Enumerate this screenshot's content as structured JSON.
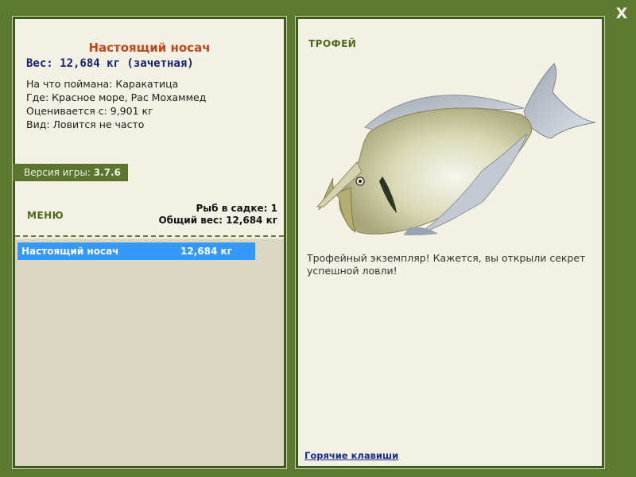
{
  "window": {
    "close_label": "X"
  },
  "fish": {
    "title": "Настоящий носач",
    "weight": "Вес: 12,684 кг (зачетная)",
    "details": [
      "На что поймана: Каракатица",
      "Где: Красное море, Рас Мохаммед",
      "Оценивается с: 9,901 кг",
      "Вид: Ловится не часто"
    ]
  },
  "version": {
    "label": "Версия игры:",
    "value": "3.7.6"
  },
  "menu": {
    "label": "МЕНЮ"
  },
  "catch_stats": {
    "count": "Рыб в садке: 1",
    "total": "Общий вес: 12,684 кг"
  },
  "catch_list": [
    {
      "name": "Настоящий носач",
      "weight": "12,684 кг"
    }
  ],
  "trophy": {
    "label": "ТРОФЕЙ",
    "text": "Трофейный экземпляр! Кажется, вы открыли секрет успешной ловли!"
  },
  "hotkeys": {
    "label": "Горячие клавиши"
  },
  "colors": {
    "background": "#5d7a33",
    "panel": "#f3f1e3",
    "title": "#c0461c",
    "weight": "#13237a",
    "selection": "#3399ff",
    "link": "#1a2c8f"
  },
  "icons": [
    "close-icon",
    "fish-illustration"
  ]
}
